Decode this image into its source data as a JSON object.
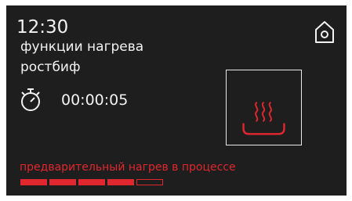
{
  "clock": "12:30",
  "function_label": "функции нагрева",
  "program": "ростбиф",
  "timer": {
    "value": "00:00:05",
    "icon": "stopwatch-icon"
  },
  "home_icon": "home-icon",
  "mode_icon": "top-bottom-heat-icon",
  "status": "предварительный нагрев в процессе",
  "progress": {
    "total_segments": 5,
    "filled_segments": 4
  },
  "colors": {
    "background": "#1e1e1e",
    "text": "#f2f2f2",
    "accent": "#e0272e"
  }
}
